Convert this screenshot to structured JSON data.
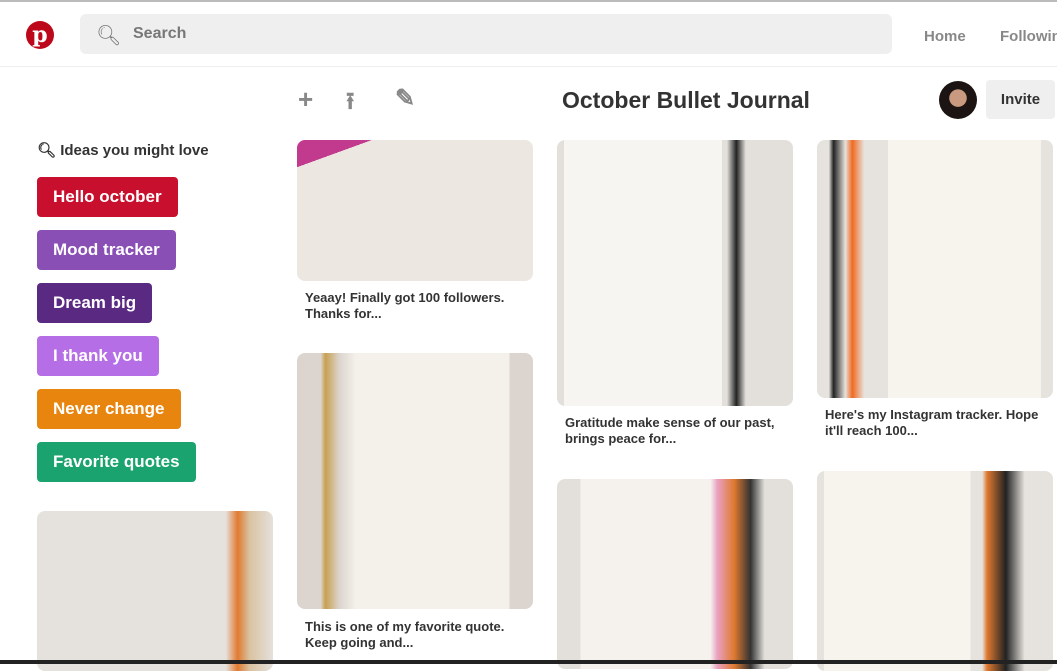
{
  "header": {
    "logo": "p",
    "search_placeholder": "Search",
    "nav": [
      "Home",
      "Following"
    ]
  },
  "toolbar": {
    "icons": [
      "plus-icon",
      "share-icon",
      "edit-icon"
    ]
  },
  "board": {
    "title": "October Bullet Journal",
    "invite_label": "Invite"
  },
  "sidebar": {
    "ideas_label": "Ideas you might love",
    "tags": [
      {
        "label": "Hello october",
        "color": "#c8102e"
      },
      {
        "label": "Mood tracker",
        "color": "#8a4fb5"
      },
      {
        "label": "Dream big",
        "color": "#5a2a82"
      },
      {
        "label": "I thank you",
        "color": "#b56ee6"
      },
      {
        "label": "Never change",
        "color": "#e8850f"
      },
      {
        "label": "Favorite quotes",
        "color": "#1aa36f"
      }
    ]
  },
  "pins": [
    {
      "caption": "Yeaay! Finally got 100 followers. Thanks for...",
      "tone": "#e9e4de"
    },
    {
      "caption": "This is one of my favorite quote. Keep going and...",
      "tone": "#dcd5cf"
    },
    {
      "caption": "Gratitude make sense of our past, brings peace for...",
      "tone": "#e3e0dc"
    },
    {
      "caption": "Here's my Instagram tracker. Hope it'll reach 100...",
      "tone": "#e6e2dd"
    }
  ]
}
